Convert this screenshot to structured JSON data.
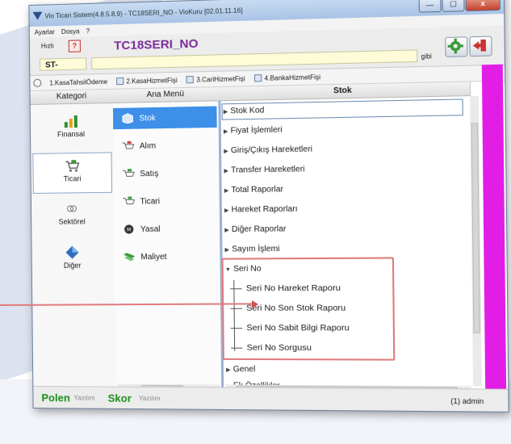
{
  "window": {
    "title": "Vio Ticari Sistem(4.8.5.8.9) - TC18SERI_NO - VioKuru [02.01.11.16]",
    "controls": {
      "minimize": "—",
      "maximize": "☐",
      "close": "x"
    }
  },
  "menubar": [
    "Ayarlar",
    "Dosya",
    "?"
  ],
  "toolbar": {
    "hizli_label": "Hızlı",
    "help": "?",
    "code_title": "TC18SERI_NO",
    "st_value": "ST-",
    "search_value": "",
    "gibi_label": "gibi"
  },
  "quickbar": [
    {
      "label": "1.KasaTahsilÖdeme"
    },
    {
      "label": "2.KasaHizmetFişi"
    },
    {
      "label": "3.CariHizmetFişi"
    },
    {
      "label": "4.BankaHizmetFişi"
    }
  ],
  "columns": {
    "kategori": "Kategori",
    "ana_menu": "Ana Menü",
    "stok": "Stok"
  },
  "kategoriler": [
    {
      "label": "Finansal",
      "icon": "chart-icon"
    },
    {
      "label": "Ticari",
      "icon": "cart-icon",
      "active": true
    },
    {
      "label": "Sektörel",
      "icon": "link-icon"
    },
    {
      "label": "Diğer",
      "icon": "diamond-icon"
    }
  ],
  "ana_menu": [
    {
      "label": "Stok",
      "active": true
    },
    {
      "label": "Alım"
    },
    {
      "label": "Satış"
    },
    {
      "label": "Ticari"
    },
    {
      "label": "Yasal"
    },
    {
      "label": "Maliyet"
    }
  ],
  "tree": {
    "items": [
      "Stok Kod",
      "Fiyat İşlemleri",
      "Giriş/Çıkış Hareketleri",
      "Transfer Hareketleri",
      "Total Raporlar",
      "Hareket Raporları",
      "Diğer Raporlar",
      "Sayım İşlemi"
    ],
    "expanded": "Seri No",
    "children": [
      "Seri No Hareket Raporu",
      "Seri No Son Stok Raporu",
      "Seri No Sabit Bilgi Raporu",
      "Seri No Sorgusu"
    ],
    "after": [
      "Genel",
      "Ek Özellikler"
    ]
  },
  "status": {
    "brand1": "Polen",
    "brand1_sub": "Yazılım",
    "brand2": "Skor",
    "brand2_sub": "Yazılım",
    "user": "(1) admin"
  },
  "colors": {
    "accent": "#3d8fe8",
    "magenta": "#e21de6",
    "highlight": "#e07b7b",
    "brand": "#1a8f1a",
    "title": "#7a2c9a"
  }
}
